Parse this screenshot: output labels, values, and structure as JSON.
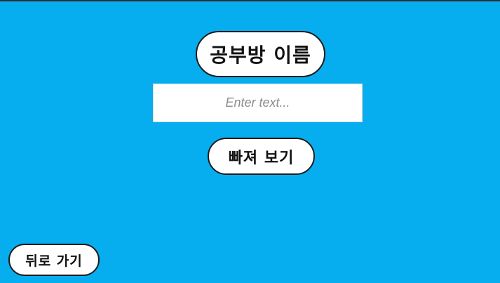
{
  "app": {
    "background_color": "#07aeef",
    "title": "공부방 이름"
  },
  "room_name_input": {
    "value": "",
    "placeholder": "Enter text..."
  },
  "buttons": {
    "enter_label": "빠져 보기",
    "back_label": "뒤로 가기"
  }
}
